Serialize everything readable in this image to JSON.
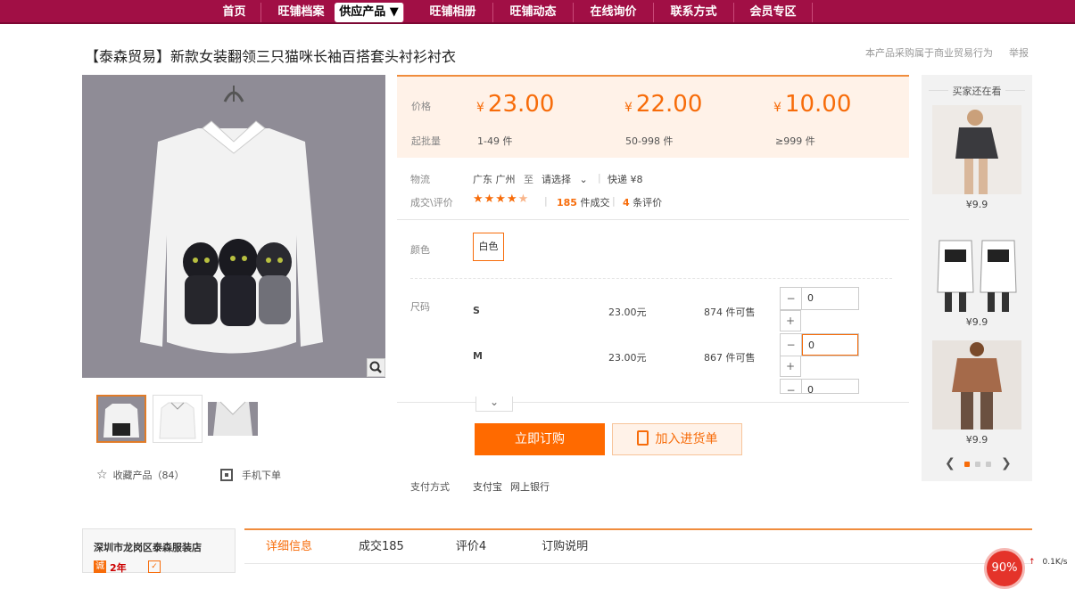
{
  "nav": {
    "items": [
      "首页",
      "旺铺档案",
      "供应产品 ▼",
      "旺铺相册",
      "旺铺动态",
      "在线询价",
      "联系方式",
      "会员专区"
    ],
    "active_index": 2
  },
  "product": {
    "title": "【泰森贸易】新款女装翻领三只猫咪长袖百搭套头衬衫衬衣",
    "notice": "本产品采购属于商业贸易行为",
    "report": "举报"
  },
  "pricing": {
    "price_label": "价格",
    "moq_label": "起批量",
    "currency": "¥",
    "tiers": [
      {
        "price": "23.00",
        "range": "1-49 件"
      },
      {
        "price": "22.00",
        "range": "50-998 件"
      },
      {
        "price": "10.00",
        "range": "≥999 件"
      }
    ]
  },
  "logistics": {
    "label": "物流",
    "from": "广东 广州",
    "to_label": "至",
    "to_placeholder": "请选择",
    "express": "快递 ¥8"
  },
  "deals": {
    "label": "成交\\评价",
    "stars": 4.5,
    "sold_count": "185",
    "sold_suffix": "件成交",
    "review_count": "4",
    "review_suffix": "条评价"
  },
  "color": {
    "label": "颜色",
    "selected": "白色"
  },
  "sizes": {
    "label": "尺码",
    "rows": [
      {
        "size": "S",
        "price": "23.00元",
        "stock": "874 件可售",
        "qty": "0"
      },
      {
        "size": "M",
        "price": "23.00元",
        "stock": "867 件可售",
        "qty": "0"
      },
      {
        "size": "",
        "price": "",
        "stock": "",
        "qty": "0"
      }
    ]
  },
  "actions": {
    "buy_now": "立即订购",
    "add_cart": "加入进货单"
  },
  "payment": {
    "label": "支付方式",
    "methods": [
      "支付宝",
      "网上银行"
    ]
  },
  "gallery": {
    "favorite_label": "收藏产品（84）",
    "mobile_label": "手机下单"
  },
  "sidebar": {
    "title": "买家还在看",
    "items": [
      {
        "price": "¥9.9"
      },
      {
        "price": "¥9.9"
      },
      {
        "price": "¥9.9"
      }
    ]
  },
  "shop": {
    "name": "深圳市龙岗区泰森服装店",
    "years": "2年"
  },
  "tabs": [
    "详细信息",
    "成交185",
    "评价4",
    "订购说明"
  ],
  "speed": {
    "percent": "90%",
    "rate": "0.1K/s"
  },
  "colors": {
    "brand": "#a10f45",
    "accent": "#ff6a00"
  }
}
